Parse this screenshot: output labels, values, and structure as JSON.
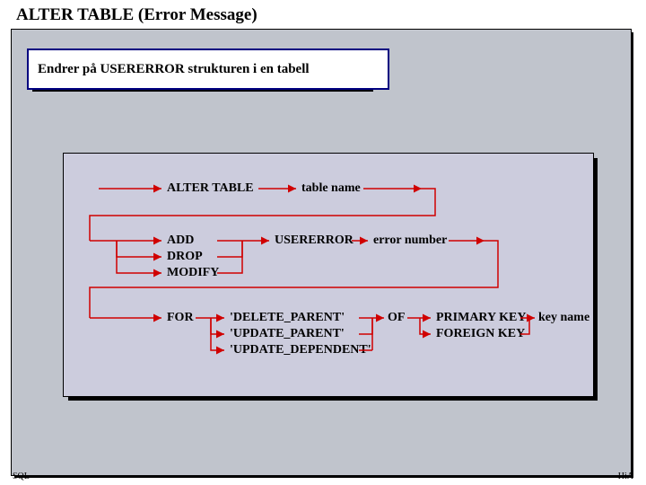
{
  "title": "ALTER TABLE  (Error Message)",
  "note": "Endrer på USERERROR strukturen i en tabell",
  "footer": {
    "left": "SQL",
    "right": "HiA"
  },
  "diagram": {
    "row1": {
      "cmd": "ALTER TABLE",
      "arg": "table name"
    },
    "row2": {
      "opts": [
        "ADD",
        "DROP",
        "MODIFY"
      ],
      "kw": "USERERROR",
      "arg": "error number"
    },
    "row3": {
      "kw": "FOR",
      "events": [
        "'DELETE_PARENT'",
        "'UPDATE_PARENT'",
        "'UPDATE_DEPENDENT'"
      ],
      "of": "OF",
      "keys": [
        "PRIMARY KEY",
        "FOREIGN KEY"
      ],
      "arg": "key name"
    }
  }
}
